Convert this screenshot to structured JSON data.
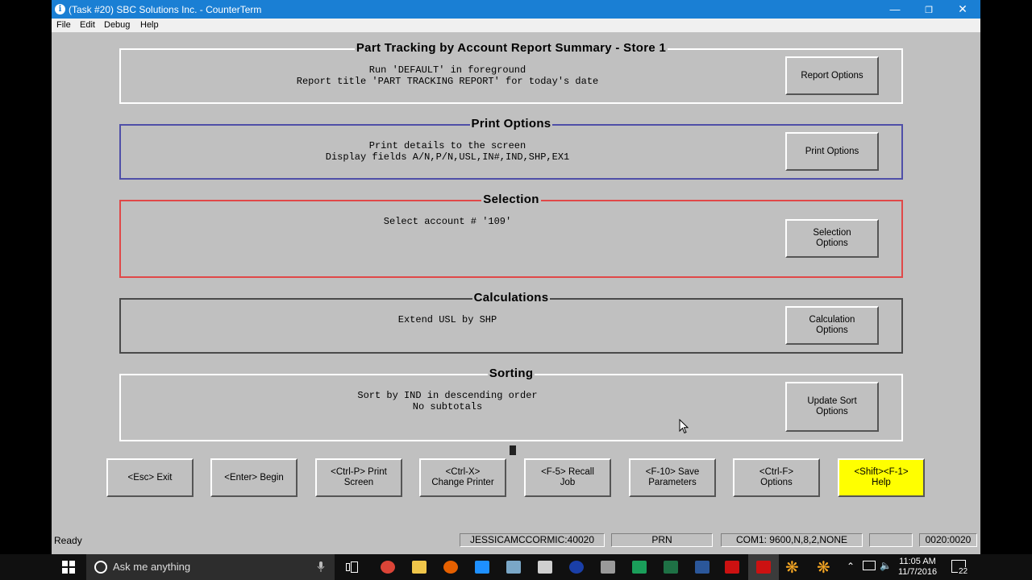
{
  "window": {
    "title": "(Task #20) SBC Solutions Inc. - CounterTerm",
    "title_icon": "info-icon",
    "controls": [
      "minimize-icon",
      "maximize-icon",
      "close-icon"
    ]
  },
  "menu": [
    "File",
    "Edit",
    "Debug",
    "Help"
  ],
  "panels": {
    "report": {
      "title": "Part Tracking by Account Report Summary - Store 1",
      "lines": [
        "Run 'DEFAULT' in foreground",
        "Report title 'PART TRACKING REPORT' for today's date"
      ],
      "button": "Report Options",
      "border_color": "#ffffff"
    },
    "print": {
      "title": "Print Options",
      "lines": [
        "Print details to the screen",
        "Display fields A/N,P/N,USL,IN#,IND,SHP,EX1"
      ],
      "button": "Print Options",
      "border_color": "#4f4fa8"
    },
    "selection": {
      "title": "Selection",
      "lines": [
        "Select account # '109'"
      ],
      "button": "Selection\nOptions",
      "border_color": "#e04848"
    },
    "calculations": {
      "title": "Calculations",
      "lines": [
        "Extend USL by SHP"
      ],
      "button": "Calculation\nOptions",
      "border_color": "#4a4a4a"
    },
    "sorting": {
      "title": "Sorting",
      "lines": [
        "Sort by IND in descending order",
        "No subtotals"
      ],
      "button": "Update Sort\nOptions",
      "border_color": "#ffffff"
    }
  },
  "function_keys": [
    {
      "label": "<Esc> Exit"
    },
    {
      "label": "<Enter> Begin"
    },
    {
      "label": "<Ctrl-P> Print\nScreen"
    },
    {
      "label": "<Ctrl-X>\nChange Printer"
    },
    {
      "label": "<F-5> Recall\nJob"
    },
    {
      "label": "<F-10> Save\nParameters"
    },
    {
      "label": "<Ctrl-F>\nOptions"
    },
    {
      "label": "<Shift><F-1>\nHelp",
      "highlight": "#ffff00"
    }
  ],
  "status": {
    "ready": "Ready",
    "user": "JESSICAMCCORMIC:40020",
    "prn": "PRN",
    "com": "COM1: 9600,N,8,2,NONE",
    "blank": "",
    "position": "0020:0020"
  },
  "taskbar": {
    "search_placeholder": "Ask me anything",
    "time": "11:05 AM",
    "date": "11/7/2016",
    "notifications": "22",
    "pinned_icons": [
      "task-view-icon",
      "chrome-icon",
      "file-explorer-icon",
      "firefox-icon",
      "store-icon",
      "paint-icon",
      "calculator-icon",
      "app-icon",
      "tools-icon",
      "sway-icon",
      "excel-icon",
      "word-icon",
      "sbc-icon",
      "sbc-icon",
      "asterisk-icon",
      "asterisk-icon"
    ]
  }
}
